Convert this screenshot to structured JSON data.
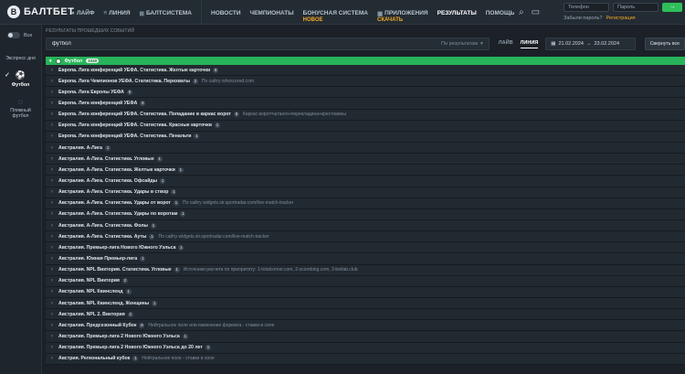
{
  "brand": {
    "name": "БАЛТБЕТ",
    "logo_glyph": "B"
  },
  "nav": [
    {
      "label": "ЛАЙФ",
      "icon": "live-icon"
    },
    {
      "label": "ЛИНИЯ",
      "icon": "line-icon"
    },
    {
      "label": "БАЛТСИСТЕМА",
      "icon": "system-icon"
    },
    {
      "label": "НОВОСТИ"
    },
    {
      "label": "ЧЕМПИОНАТЫ"
    },
    {
      "label": "БОНУСНАЯ СИСТЕМА",
      "sub": "НОВОЕ"
    },
    {
      "label": "ПРИЛОЖЕНИЯ",
      "sub": "СКАЧАТЬ",
      "icon": "apps-icon"
    },
    {
      "label": "РЕЗУЛЬТАТЫ",
      "active": true
    },
    {
      "label": "ПОМОЩЬ"
    }
  ],
  "login": {
    "phone_placeholder": "Телефон",
    "password_placeholder": "Пароль",
    "go_glyph": "→",
    "forgot": "Забыли пароль?",
    "register": "Регистрация"
  },
  "sidebar": {
    "toggle_label": "Все",
    "items": [
      {
        "label": "Экспресс дня",
        "icon": "express-icon"
      },
      {
        "label": "Футбол",
        "icon": "football-icon",
        "active": true
      },
      {
        "label": "Пляжный футбол",
        "icon": "beach-football-icon"
      }
    ]
  },
  "breadcrumb": "РЕЗУЛЬТАТЫ ПРОШЕДШИХ СОБЫТИЙ",
  "filter": {
    "search_value": "футбол",
    "scope_label": "По результатам",
    "tabs": [
      {
        "label": "ЛАЙВ",
        "active": false
      },
      {
        "label": "ЛИНИЯ",
        "active": true
      }
    ],
    "date_from": "21.02.2024",
    "date_to": "23.02.2024",
    "date_separator": "→",
    "collapse_label": "Свернуть все"
  },
  "sport": {
    "name": "Футбол",
    "count": "1040"
  },
  "tournaments": [
    {
      "name": "Европа. Лига конференций УЕФА. Статистика. Желтые карточки",
      "count": "8",
      "note": ""
    },
    {
      "name": "Европа. Лига Чемпионов УЕФА. Статистика. Перехваты",
      "count": "2",
      "note": "По сайту whoscored.com"
    },
    {
      "name": "Европа. Лига Европы УЕФА",
      "count": "8",
      "note": ""
    },
    {
      "name": "Европа. Лига конференций УЕФА",
      "count": "8",
      "note": ""
    },
    {
      "name": "Европа. Лига конференций УЕФА. Статистика. Попадание в каркас ворот",
      "count": "8",
      "note": "Каркас ворот=штанги+перекладина+крестовины"
    },
    {
      "name": "Европа. Лига конференций УЕФА. Статистика. Красные карточки",
      "count": "1",
      "note": ""
    },
    {
      "name": "Европа. Лига конференций УЕФА. Статистика. Пенальти",
      "count": "1",
      "note": ""
    },
    {
      "name": "Австралия. А-Лига",
      "count": "1",
      "note": ""
    },
    {
      "name": "Австралия. А-Лига. Статистика. Угловые",
      "count": "1",
      "note": ""
    },
    {
      "name": "Австралия. А-Лига. Статистика. Желтые карточки",
      "count": "1",
      "note": ""
    },
    {
      "name": "Австралия. А-Лига. Статистика. Офсайды",
      "count": "1",
      "note": ""
    },
    {
      "name": "Австралия. А-Лига. Статистика. Удары в створ",
      "count": "1",
      "note": ""
    },
    {
      "name": "Австралия. А-Лига. Статистика. Удары от ворот",
      "count": "1",
      "note": "По сайту widgets.sir.sportradar.com/live-match-tracker"
    },
    {
      "name": "Австралия. А-Лига. Статистика. Удары по воротам",
      "count": "1",
      "note": ""
    },
    {
      "name": "Австралия. А-Лига. Статистика. Фолы",
      "count": "1",
      "note": ""
    },
    {
      "name": "Австралия. А-Лига. Статистика. Ауты",
      "count": "1",
      "note": "По сайту widgets.sir.sportradar.com/live-match-tracker"
    },
    {
      "name": "Австралия. Премьер-лига Нового Южного Уэльса",
      "count": "1",
      "note": ""
    },
    {
      "name": "Австралия. Южная Премьер-лига",
      "count": "1",
      "note": ""
    },
    {
      "name": "Австралия. NPL Виктория. Статистика. Угловые",
      "count": "1",
      "note": "Источники расчета по приоритету: 1-totalcorner.com, 2-scorebing.com, 3-betlab.club"
    },
    {
      "name": "Австралия. NPL Виктория",
      "count": "2",
      "note": ""
    },
    {
      "name": "Австралия. NPL Квинсленд",
      "count": "1",
      "note": ""
    },
    {
      "name": "Австралия. NPL Квинсленд. Женщины",
      "count": "1",
      "note": ""
    },
    {
      "name": "Австралия. NPL 2. Виктория",
      "count": "2",
      "note": ""
    },
    {
      "name": "Австралия. Предсезонный Кубок",
      "count": "8",
      "note": "Нейтральное поле или изменение формата - ставки в силе"
    },
    {
      "name": "Австралия. Премьер-лига 2 Нового Южного Уэльса",
      "count": "1",
      "note": ""
    },
    {
      "name": "Австралия. Премьер-лига 2 Нового Южного Уэльса до 20 лет",
      "count": "1",
      "note": ""
    },
    {
      "name": "Австрия. Региональный кубок",
      "count": "1",
      "note": "Нейтральное поле - ставки в силе"
    }
  ]
}
